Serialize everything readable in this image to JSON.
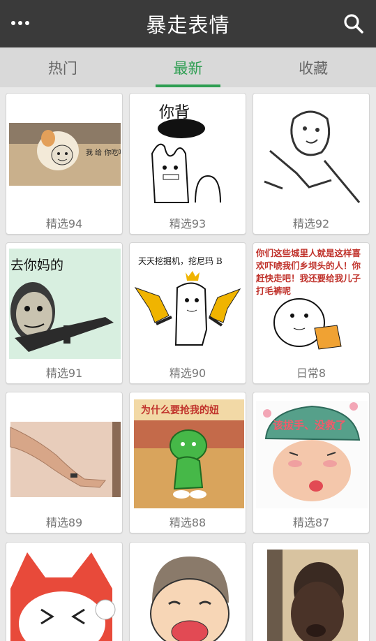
{
  "header": {
    "title": "暴走表情",
    "menu_icon": "more-dots-icon",
    "search_icon": "search-icon"
  },
  "tabs": [
    {
      "label": "热门",
      "active": false
    },
    {
      "label": "最新",
      "active": true
    },
    {
      "label": "收藏",
      "active": false
    }
  ],
  "colors": {
    "header_bg": "#3a3a3a",
    "tab_bar_bg": "#d9d9d9",
    "accent": "#2e9e52",
    "page_bg": "#e9e9e9"
  },
  "cards": [
    {
      "label": "精选94",
      "thumb_text": "我 给 你吃吧"
    },
    {
      "label": "精选93",
      "thumb_text": "你背"
    },
    {
      "label": "精选92",
      "thumb_text": ""
    },
    {
      "label": "精选91",
      "thumb_text": "去你妈的"
    },
    {
      "label": "精选90",
      "thumb_text": "天天挖掘机，挖尼玛 B"
    },
    {
      "label": "日常8",
      "thumb_text": "你们这些城里人就是这样喜欢吓唬我们乡坝头的人！你赶快走吧！我还要给我儿子打毛裤呢"
    },
    {
      "label": "精选89",
      "thumb_text": ""
    },
    {
      "label": "精选88",
      "thumb_text": "为什么要抢我的妞"
    },
    {
      "label": "精选87",
      "thumb_text": "该拔手、没救了"
    },
    {
      "label": "",
      "thumb_text": ""
    },
    {
      "label": "",
      "thumb_text": ""
    },
    {
      "label": "",
      "thumb_text": ""
    }
  ]
}
